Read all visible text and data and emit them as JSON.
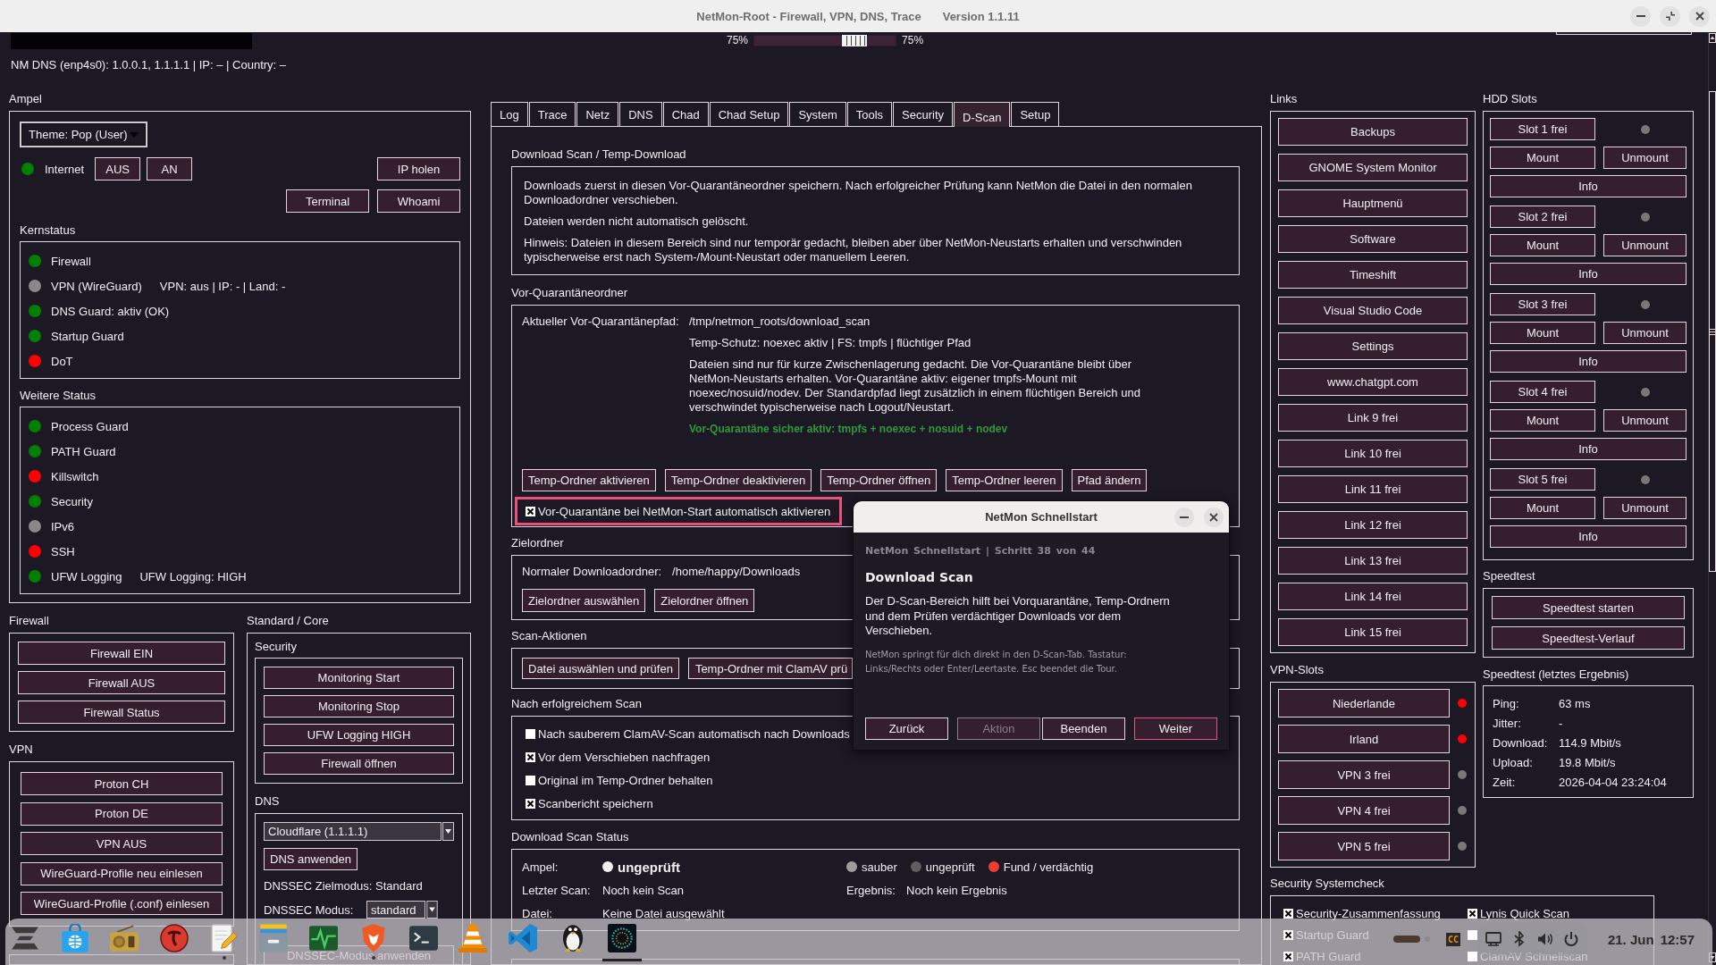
{
  "window": {
    "title": "NetMon-Root - Firewall, VPN, DNS, Trace",
    "version": "Version 1.1.11"
  },
  "top_bar": {
    "zoom": {
      "left_label": "75%",
      "level": 0.75,
      "right_label": "75%"
    },
    "dns_info": "NM DNS (enp4s0): 1.0.0.1, 1.1.1.1 | IP: – | Country: –"
  },
  "ampel": {
    "title": "Ampel",
    "theme": "Theme: Pop (User)",
    "internet": {
      "label": "Internet",
      "color": "#008000"
    },
    "internet_buttons": [
      "AUS",
      "AN"
    ],
    "ip_button": "IP holen",
    "tool_buttons": [
      "Terminal",
      "Whoami"
    ],
    "core_status": {
      "title": "Kernstatus",
      "items": [
        {
          "label": "Firewall",
          "color": "#008000"
        },
        {
          "label": "VPN (WireGuard)",
          "color": "#888888",
          "detail": "VPN: aus | IP: - | Land: -"
        },
        {
          "label": "DNS Guard: aktiv (OK)",
          "color": "#008000"
        },
        {
          "label": "Startup Guard",
          "color": "#008000"
        },
        {
          "label": "DoT",
          "color": "#ff0000"
        }
      ]
    },
    "more_status": {
      "title": "Weitere Status",
      "items": [
        {
          "label": "Process Guard",
          "color": "#008000"
        },
        {
          "label": "PATH Guard",
          "color": "#008000"
        },
        {
          "label": "Killswitch",
          "color": "#ff0000"
        },
        {
          "label": "Security",
          "color": "#008000"
        },
        {
          "label": "IPv6",
          "color": "#888888"
        },
        {
          "label": "SSH",
          "color": "#ff0000"
        },
        {
          "label": "UFW Logging",
          "color": "#008000",
          "detail": "UFW Logging: HIGH"
        }
      ]
    }
  },
  "firewall": {
    "title": "Firewall",
    "buttons": [
      "Firewall EIN",
      "Firewall AUS",
      "Firewall Status"
    ]
  },
  "vpn": {
    "title": "VPN",
    "buttons": [
      "Proton CH",
      "Proton DE",
      "VPN AUS",
      "WireGuard-Profile neu einlesen",
      "WireGuard-Profile (.conf) einlesen"
    ]
  },
  "standard_core": {
    "title": "Standard / Core",
    "security": {
      "title": "Security",
      "buttons": [
        "Monitoring Start",
        "Monitoring Stop",
        "UFW Logging HIGH",
        "Firewall öffnen"
      ]
    },
    "dns": {
      "title": "DNS",
      "provider": "Cloudflare (1.1.1.1)",
      "apply_button": "DNS anwenden",
      "target_mode": "DNSSEC Zielmodus: Standard",
      "mode_label": "DNSSEC Modus:",
      "mode": "standard",
      "mode_apply_button": "DNSSEC-Modus anwenden"
    }
  },
  "tabs": [
    {
      "label": "Log",
      "selected": false
    },
    {
      "label": "Trace",
      "selected": false
    },
    {
      "label": "Netz",
      "selected": false
    },
    {
      "label": "DNS",
      "selected": false
    },
    {
      "label": "Chad",
      "selected": false
    },
    {
      "label": "Chad Setup",
      "selected": false
    },
    {
      "label": "System",
      "selected": false
    },
    {
      "label": "Tools",
      "selected": false
    },
    {
      "label": "Security",
      "selected": false
    },
    {
      "label": "D-Scan",
      "selected": true
    },
    {
      "label": "Setup",
      "selected": false
    }
  ],
  "dscan": {
    "intro": {
      "title": "Download Scan / Temp-Download",
      "paragraphs": [
        "Downloads zuerst in diesen Vor-Quarantäneordner speichern. Nach erfolgreicher Prüfung kann NetMon die Datei in den normalen Downloadordner verschieben.",
        "Dateien werden nicht automatisch gelöscht.",
        "Hinweis: Dateien in diesem Bereich sind nur temporär gedacht, bleiben aber über NetMon-Neustarts erhalten und verschwinden typischerweise erst nach System-/Mount-Neustart oder manuellem Leeren."
      ]
    },
    "quarantine": {
      "title": "Vor-Quarantäneordner",
      "path_label": "Aktueller Vor-Quarantänepfad:",
      "path": "/tmp/netmon_roots/download_scan",
      "protection": "Temp-Schutz: noexec aktiv | FS: tmpfs | flüchtiger Pfad",
      "description": "Dateien sind nur für kurze Zwischenlagerung gedacht. Die Vor-Quarantäne bleibt über NetMon-Neustarts erhalten. Vor-Quarantäne aktiv: eigener tmpfs-Mount mit noexec/nosuid/nodev. Der Standardpfad liegt zusätzlich in einem flüchtigen Bereich und verschwindet typischerweise nach Logout/Neustart.",
      "secure_status": "Vor-Quarantäne sicher aktiv: tmpfs + noexec + nosuid + nodev",
      "buttons": [
        "Temp-Ordner aktivieren",
        "Temp-Ordner deaktivieren",
        "Temp-Ordner öffnen",
        "Temp-Ordner leeren",
        "Pfad ändern"
      ],
      "autostart": {
        "label": "Vor-Quarantäne bei NetMon-Start automatisch aktivieren",
        "checked": true,
        "focused": true
      }
    },
    "target": {
      "title": "Zielordner",
      "label": "Normaler Downloadordner:",
      "path": "/home/happy/Downloads",
      "buttons": [
        "Zielordner auswählen",
        "Zielordner öffnen"
      ]
    },
    "scan_actions": {
      "title": "Scan-Aktionen",
      "buttons": [
        "Datei auswählen und prüfen",
        "Temp-Ordner mit ClamAV prü"
      ]
    },
    "after_scan": {
      "title": "Nach erfolgreichem Scan",
      "options": [
        {
          "label": "Nach sauberem ClamAV-Scan automatisch nach Downloads",
          "checked": false
        },
        {
          "label": "Vor dem Verschieben nachfragen",
          "checked": true
        },
        {
          "label": "Original im Temp-Ordner behalten",
          "checked": false
        },
        {
          "label": "Scanbericht speichern",
          "checked": true
        }
      ]
    },
    "status": {
      "title": "Download Scan Status",
      "ampel": {
        "label": "Ampel:",
        "value": "ungeprüft",
        "color": "#f0f0f0"
      },
      "legend": [
        {
          "label": "sauber",
          "color": "#9e9e9e"
        },
        {
          "label": "ungeprüft",
          "color": "#5e5e5e"
        },
        {
          "label": "Fund / verdächtig",
          "color": "#f03a30"
        }
      ],
      "rows": [
        {
          "label": "Letzter Scan:",
          "value": "Noch kein Scan",
          "extra_label": "Ergebnis:",
          "extra_value": "Noch kein Ergebnis"
        },
        {
          "label": "Datei:",
          "value": "Keine Datei ausgewählt"
        }
      ]
    }
  },
  "dialog": {
    "title": "NetMon Schnellstart",
    "step": "NetMon Schnellstart | Schritt 38 von 44",
    "heading": "Download Scan",
    "text": "Der D-Scan-Bereich hilft bei Vorquarantäne, Temp-Ordnern und dem Prüfen verdächtiger Downloads vor dem Verschieben.",
    "hint": "NetMon springt für dich direkt in den D-Scan-Tab. Tastatur: Links/Rechts oder Enter/Leertaste. Esc beendet die Tour.",
    "buttons": [
      {
        "label": "Zurück",
        "disabled": false,
        "focused": false
      },
      {
        "label": "Aktion",
        "disabled": true,
        "focused": false
      },
      {
        "label": "Beenden",
        "disabled": false,
        "focused": false
      },
      {
        "label": "Weiter",
        "disabled": false,
        "focused": true
      }
    ]
  },
  "links": {
    "title": "Links",
    "buttons": [
      "Backups",
      "GNOME System Monitor",
      "Hauptmenü",
      "Software",
      "Timeshift",
      "Visual Studio Code",
      "Settings",
      "www.chatgpt.com",
      "Link 9 frei",
      "Link 10 frei",
      "Link 11 frei",
      "Link 12 frei",
      "Link 13 frei",
      "Link 14 frei",
      "Link 15 frei"
    ]
  },
  "hdd_slots": {
    "title": "HDD Slots",
    "slots": [
      {
        "label": "Slot 1 frei",
        "color": "#777777",
        "mount": "Mount",
        "unmount": "Unmount",
        "info": "Info"
      },
      {
        "label": "Slot 2 frei",
        "color": "#777777",
        "mount": "Mount",
        "unmount": "Unmount",
        "info": "Info"
      },
      {
        "label": "Slot 3 frei",
        "color": "#777777",
        "mount": "Mount",
        "unmount": "Unmount",
        "info": "Info"
      },
      {
        "label": "Slot 4 frei",
        "color": "#777777",
        "mount": "Mount",
        "unmount": "Unmount",
        "info": "Info"
      },
      {
        "label": "Slot 5 frei",
        "color": "#777777",
        "mount": "Mount",
        "unmount": "Unmount",
        "info": "Info"
      }
    ]
  },
  "speedtest": {
    "title": "Speedtest",
    "buttons": [
      "Speedtest starten",
      "Speedtest-Verlauf"
    ]
  },
  "speedtest_result": {
    "title": "Speedtest (letztes Ergebnis)",
    "rows": [
      {
        "label": "Ping:",
        "value": "63 ms"
      },
      {
        "label": "Jitter:",
        "value": "-"
      },
      {
        "label": "Download:",
        "value": "114.9 Mbit/s"
      },
      {
        "label": "Upload:",
        "value": "19.8 Mbit/s"
      },
      {
        "label": "Zeit:",
        "value": "2026-04-04 23:24:04"
      }
    ]
  },
  "vpn_slots": {
    "title": "VPN-Slots",
    "slots": [
      {
        "label": "Niederlande",
        "color": "#ff0000"
      },
      {
        "label": "Irland",
        "color": "#ff0000"
      },
      {
        "label": "VPN 3 frei",
        "color": "#777777"
      },
      {
        "label": "VPN 4 frei",
        "color": "#777777"
      },
      {
        "label": "VPN 5 frei",
        "color": "#777777"
      }
    ]
  },
  "security_check": {
    "title": "Security Systemcheck",
    "options": [
      {
        "label": "Security-Zusammenfassung",
        "checked": true
      },
      {
        "label": "Lynis Quick Scan",
        "checked": true
      },
      {
        "label": "Startup Guard",
        "checked": true
      },
      {
        "checked": false
      },
      {
        "label": "PATH Guard",
        "checked": true
      },
      {
        "label": "ClamAV Schnellscan",
        "checked": false
      }
    ]
  },
  "taskbar": {
    "apps": [
      {
        "kind": "menu",
        "running": false,
        "active": false
      },
      {
        "kind": "store",
        "running": false,
        "active": false
      },
      {
        "kind": "radio",
        "running": false,
        "active": false
      },
      {
        "kind": "emblem",
        "running": false,
        "active": false
      },
      {
        "kind": "notes",
        "running": true,
        "active": false
      },
      {
        "kind": "files",
        "running": false,
        "active": false
      },
      {
        "kind": "monitor",
        "running": false,
        "active": false
      },
      {
        "kind": "browser",
        "running": true,
        "active": false
      },
      {
        "kind": "terminal",
        "running": false,
        "active": false
      },
      {
        "kind": "player",
        "running": false,
        "active": false
      },
      {
        "kind": "editor",
        "running": false,
        "active": false
      },
      {
        "kind": "penguin",
        "running": false,
        "active": false
      },
      {
        "kind": "globe",
        "running": true,
        "active": true
      }
    ],
    "indicator_label": "CC",
    "date": "21. Jun",
    "time": "12:57"
  }
}
